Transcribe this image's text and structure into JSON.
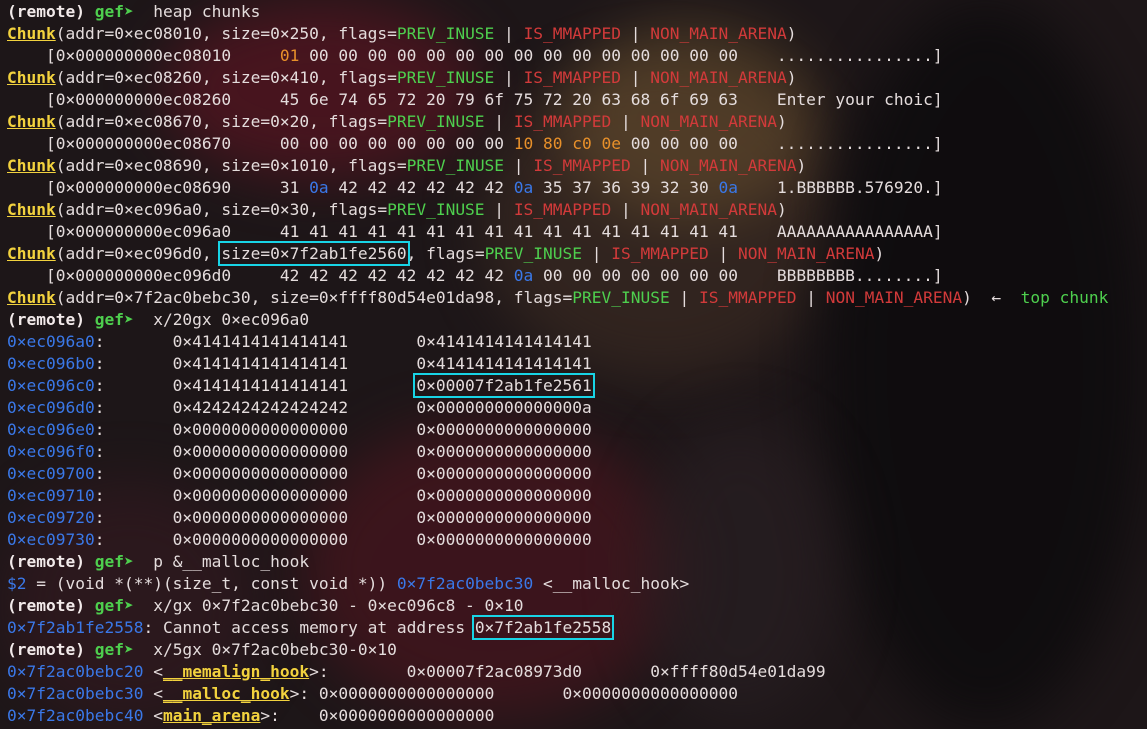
{
  "background": {
    "colors": [
      "#5a1420",
      "#8a1a2a",
      "#302628",
      "#c8a040",
      "#1a1416"
    ]
  },
  "lines": [
    [
      {
        "t": "(remote) ",
        "c": "c-b"
      },
      {
        "t": "gef➤ ",
        "c": "ptr"
      },
      {
        "t": " heap chunks",
        "c": ""
      }
    ],
    [
      {
        "t": "Chunk",
        "c": "c-yel"
      },
      {
        "t": "(addr=0×ec08010, size=0×250, flags=",
        "c": ""
      },
      {
        "t": "PREV_INUSE",
        "c": "c-green"
      },
      {
        "t": " | ",
        "c": ""
      },
      {
        "t": "IS_MMAPPED",
        "c": "c-red"
      },
      {
        "t": " | ",
        "c": ""
      },
      {
        "t": "NON_MAIN_ARENA",
        "c": "c-red"
      },
      {
        "t": ")",
        "c": ""
      }
    ],
    [
      {
        "t": "    [0×000000000ec08010     ",
        "c": ""
      },
      {
        "t": "01",
        "c": "c-orange"
      },
      {
        "t": " 00 00 00 00 00 00 00 00 00 00 00 00 00 00 00    ................]",
        "c": ""
      }
    ],
    [
      {
        "t": "Chunk",
        "c": "c-yel"
      },
      {
        "t": "(addr=0×ec08260, size=0×410, flags=",
        "c": ""
      },
      {
        "t": "PREV_INUSE",
        "c": "c-green"
      },
      {
        "t": " | ",
        "c": ""
      },
      {
        "t": "IS_MMAPPED",
        "c": "c-red"
      },
      {
        "t": " | ",
        "c": ""
      },
      {
        "t": "NON_MAIN_ARENA",
        "c": "c-red"
      },
      {
        "t": ")",
        "c": ""
      }
    ],
    [
      {
        "t": "    [0×000000000ec08260     45 6e 74 65 72 20 79 6f 75 72 20 63 68 6f 69 63    Enter your choic]",
        "c": ""
      }
    ],
    [
      {
        "t": "Chunk",
        "c": "c-yel"
      },
      {
        "t": "(addr=0×ec08670, size=0×20, flags=",
        "c": ""
      },
      {
        "t": "PREV_INUSE",
        "c": "c-green"
      },
      {
        "t": " | ",
        "c": ""
      },
      {
        "t": "IS_MMAPPED",
        "c": "c-red"
      },
      {
        "t": " | ",
        "c": ""
      },
      {
        "t": "NON_MAIN_ARENA",
        "c": "c-red"
      },
      {
        "t": ")",
        "c": ""
      }
    ],
    [
      {
        "t": "    [0×000000000ec08670     00 00 00 00 00 00 00 00 ",
        "c": ""
      },
      {
        "t": "10 80 c0 0e",
        "c": "c-orange"
      },
      {
        "t": " 00 00 00 00    ................]",
        "c": ""
      }
    ],
    [
      {
        "t": "Chunk",
        "c": "c-yel"
      },
      {
        "t": "(addr=0×ec08690, size=0×1010, flags=",
        "c": ""
      },
      {
        "t": "PREV_INUSE",
        "c": "c-green"
      },
      {
        "t": " | ",
        "c": ""
      },
      {
        "t": "IS_MMAPPED",
        "c": "c-red"
      },
      {
        "t": " | ",
        "c": ""
      },
      {
        "t": "NON_MAIN_ARENA",
        "c": "c-red"
      },
      {
        "t": ")",
        "c": ""
      }
    ],
    [
      {
        "t": "    [0×000000000ec08690     31 ",
        "c": ""
      },
      {
        "t": "0a",
        "c": "c-blue"
      },
      {
        "t": " 42 42 42 42 42 42 ",
        "c": ""
      },
      {
        "t": "0a",
        "c": "c-blue"
      },
      {
        "t": " 35 37 36 39 32 30 ",
        "c": ""
      },
      {
        "t": "0a",
        "c": "c-blue"
      },
      {
        "t": "    1.BBBBBB.576920.]",
        "c": ""
      }
    ],
    [
      {
        "t": "Chunk",
        "c": "c-yel"
      },
      {
        "t": "(addr=0×ec096a0, size=0×30, flags=",
        "c": ""
      },
      {
        "t": "PREV_INUSE",
        "c": "c-green"
      },
      {
        "t": " | ",
        "c": ""
      },
      {
        "t": "IS_MMAPPED",
        "c": "c-red"
      },
      {
        "t": " | ",
        "c": ""
      },
      {
        "t": "NON_MAIN_ARENA",
        "c": "c-red"
      },
      {
        "t": ")",
        "c": ""
      }
    ],
    [
      {
        "t": "    [0×000000000ec096a0     41 41 41 41 41 41 41 41 41 41 41 41 41 41 41 41    AAAAAAAAAAAAAAAA]",
        "c": ""
      }
    ],
    [
      {
        "t": "Chunk",
        "c": "c-yel"
      },
      {
        "t": "(addr=0×ec096d0, ",
        "c": ""
      },
      {
        "t": "size=0×7f2ab1fe2560",
        "c": "box"
      },
      {
        "t": ", flags=",
        "c": ""
      },
      {
        "t": "PREV_INUSE",
        "c": "c-green"
      },
      {
        "t": " | ",
        "c": ""
      },
      {
        "t": "IS_MMAPPED",
        "c": "c-red"
      },
      {
        "t": " | ",
        "c": ""
      },
      {
        "t": "NON_MAIN_ARENA",
        "c": "c-red"
      },
      {
        "t": ")",
        "c": ""
      }
    ],
    [
      {
        "t": "    [0×000000000ec096d0     42 42 42 42 42 42 42 42 ",
        "c": ""
      },
      {
        "t": "0a",
        "c": "c-blue"
      },
      {
        "t": " 00 00 00 00 00 00 00    BBBBBBBB........]",
        "c": ""
      }
    ],
    [
      {
        "t": "Chunk",
        "c": "c-yel"
      },
      {
        "t": "(addr=0×7f2ac0bebc30, size=0×ffff80d54e01da98, flags=",
        "c": ""
      },
      {
        "t": "PREV_INUSE",
        "c": "c-green"
      },
      {
        "t": " | ",
        "c": ""
      },
      {
        "t": "IS_MMAPPED",
        "c": "c-red"
      },
      {
        "t": " | ",
        "c": ""
      },
      {
        "t": "NON_MAIN_ARENA",
        "c": "c-red"
      },
      {
        "t": ")  ←  ",
        "c": ""
      },
      {
        "t": "top chunk",
        "c": "c-green"
      }
    ],
    [
      {
        "t": "(remote) ",
        "c": "c-b"
      },
      {
        "t": "gef➤ ",
        "c": "ptr"
      },
      {
        "t": " x/20gx 0×ec096a0",
        "c": ""
      }
    ],
    [
      {
        "t": "0×ec096a0",
        "c": "c-blue"
      },
      {
        "t": ":       0×4141414141414141       0×4141414141414141",
        "c": ""
      }
    ],
    [
      {
        "t": "0×ec096b0",
        "c": "c-blue"
      },
      {
        "t": ":       0×4141414141414141       0×4141414141414141",
        "c": ""
      }
    ],
    [
      {
        "t": "0×ec096c0",
        "c": "c-blue"
      },
      {
        "t": ":       0×4141414141414141       ",
        "c": ""
      },
      {
        "t": "0×00007f2ab1fe2561",
        "c": "box"
      }
    ],
    [
      {
        "t": "0×ec096d0",
        "c": "c-blue"
      },
      {
        "t": ":       0×4242424242424242       0×000000000000000a",
        "c": ""
      }
    ],
    [
      {
        "t": "0×ec096e0",
        "c": "c-blue"
      },
      {
        "t": ":       0×0000000000000000       0×0000000000000000",
        "c": ""
      }
    ],
    [
      {
        "t": "0×ec096f0",
        "c": "c-blue"
      },
      {
        "t": ":       0×0000000000000000       0×0000000000000000",
        "c": ""
      }
    ],
    [
      {
        "t": "0×ec09700",
        "c": "c-blue"
      },
      {
        "t": ":       0×0000000000000000       0×0000000000000000",
        "c": ""
      }
    ],
    [
      {
        "t": "0×ec09710",
        "c": "c-blue"
      },
      {
        "t": ":       0×0000000000000000       0×0000000000000000",
        "c": ""
      }
    ],
    [
      {
        "t": "0×ec09720",
        "c": "c-blue"
      },
      {
        "t": ":       0×0000000000000000       0×0000000000000000",
        "c": ""
      }
    ],
    [
      {
        "t": "0×ec09730",
        "c": "c-blue"
      },
      {
        "t": ":       0×0000000000000000       0×0000000000000000",
        "c": ""
      }
    ],
    [
      {
        "t": "(remote) ",
        "c": "c-b"
      },
      {
        "t": "gef➤ ",
        "c": "ptr"
      },
      {
        "t": " p &__malloc_hook",
        "c": ""
      }
    ],
    [
      {
        "t": "$2",
        "c": "c-blue"
      },
      {
        "t": " = (void *(**)(size_t, const void *)) ",
        "c": ""
      },
      {
        "t": "0×7f2ac0bebc30",
        "c": "c-blue"
      },
      {
        "t": " <__malloc_hook>",
        "c": ""
      }
    ],
    [
      {
        "t": "(remote) ",
        "c": "c-b"
      },
      {
        "t": "gef➤ ",
        "c": "ptr"
      },
      {
        "t": " x/gx 0×7f2ac0bebc30 - 0×ec096c8 - 0×10",
        "c": ""
      }
    ],
    [
      {
        "t": "0×7f2ab1fe2558",
        "c": "c-blue"
      },
      {
        "t": ": Cannot access memory at address ",
        "c": ""
      },
      {
        "t": "0×7f2ab1fe2558",
        "c": "box"
      }
    ],
    [
      {
        "t": "(remote) ",
        "c": "c-b"
      },
      {
        "t": "gef➤ ",
        "c": "ptr"
      },
      {
        "t": " x/5gx 0×7f2ac0bebc30-0×10",
        "c": ""
      }
    ],
    [
      {
        "t": "0×7f2ac0bebc20",
        "c": "c-blue"
      },
      {
        "t": " <",
        "c": ""
      },
      {
        "t": "__memalign_hook",
        "c": "c-yel"
      },
      {
        "t": ">:        0×00007f2ac08973d0       0×ffff80d54e01da99",
        "c": ""
      }
    ],
    [
      {
        "t": "0×7f2ac0bebc30",
        "c": "c-blue"
      },
      {
        "t": " <",
        "c": ""
      },
      {
        "t": "__malloc_hook",
        "c": "c-yel"
      },
      {
        "t": ">: 0×0000000000000000       0×0000000000000000",
        "c": ""
      }
    ],
    [
      {
        "t": "0×7f2ac0bebc40",
        "c": "c-blue"
      },
      {
        "t": " <",
        "c": ""
      },
      {
        "t": "main_arena",
        "c": "c-yel"
      },
      {
        "t": ">:    0×0000000000000000",
        "c": ""
      }
    ]
  ]
}
